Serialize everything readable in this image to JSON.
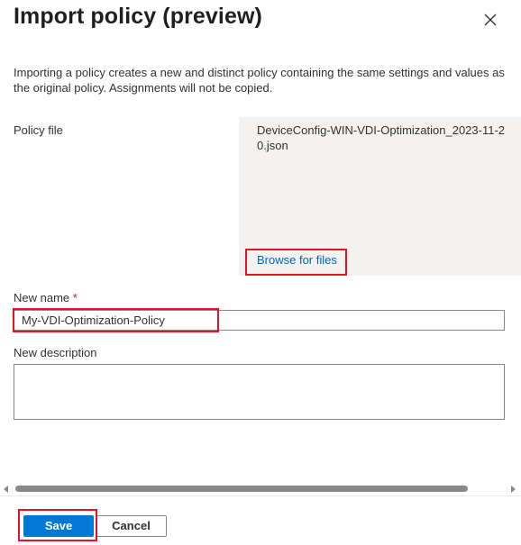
{
  "header": {
    "title": "Import policy (preview)",
    "close_icon": "close-icon"
  },
  "intro_text": "Importing a policy creates a new and distinct policy containing the same settings and values as the original policy. Assignments will not be copied.",
  "policy_file": {
    "label": "Policy file",
    "file_name": "DeviceConfig-WIN-VDI-Optimization_2023-11-20.json",
    "browse_label": "Browse for files"
  },
  "new_name": {
    "label": "New name",
    "required_marker": "*",
    "value": "My-VDI-Optimization-Policy"
  },
  "new_description": {
    "label": "New description",
    "value": ""
  },
  "footer": {
    "save_label": "Save",
    "cancel_label": "Cancel"
  },
  "colors": {
    "accent": "#0078d4",
    "link": "#0067b8",
    "highlight": "#e81123",
    "file_box_bg": "#f3f2f1"
  }
}
